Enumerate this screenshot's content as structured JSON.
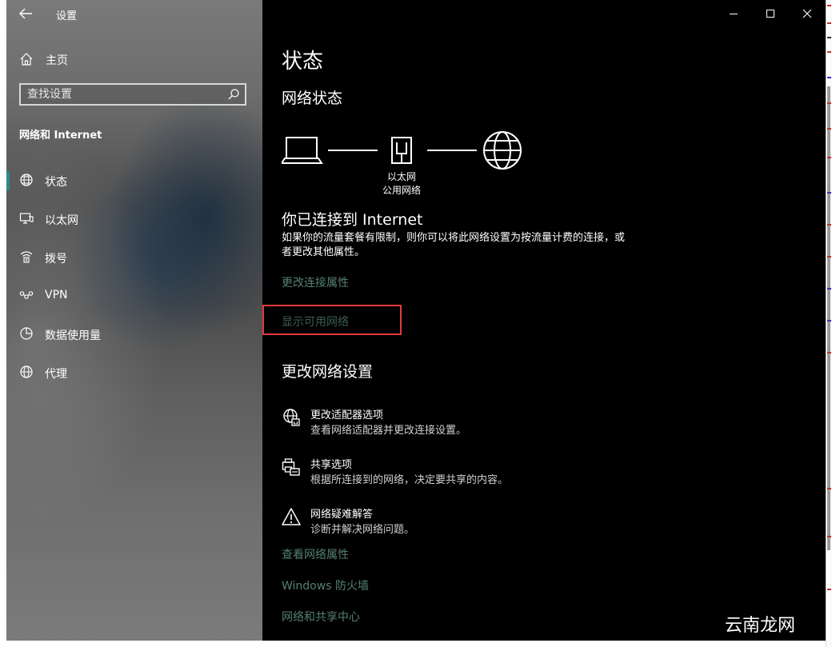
{
  "app": {
    "title": "设置"
  },
  "sidebar": {
    "home_label": "主页",
    "search_placeholder": "查找设置",
    "section_title": "网络和 Internet",
    "items": [
      {
        "label": "状态",
        "icon": "globe-status-icon",
        "active": true
      },
      {
        "label": "以太网",
        "icon": "ethernet-icon",
        "active": false
      },
      {
        "label": "拨号",
        "icon": "dialup-icon",
        "active": false
      },
      {
        "label": "VPN",
        "icon": "vpn-icon",
        "active": false
      },
      {
        "label": "数据使用量",
        "icon": "data-usage-icon",
        "active": false
      },
      {
        "label": "代理",
        "icon": "proxy-globe-icon",
        "active": false
      }
    ]
  },
  "main": {
    "title": "状态",
    "network_status_heading": "网络状态",
    "network": {
      "name": "以太网",
      "type": "公用网络"
    },
    "connected_heading": "你已连接到 Internet",
    "description": "如果你的流量套餐有限制，则你可以将此网络设置为按流量计费的连接，或者更改其他属性。",
    "links_top": {
      "change_properties": "更改连接属性",
      "show_networks": "显示可用网络"
    },
    "change_settings_heading": "更改网络设置",
    "options": [
      {
        "title": "更改适配器选项",
        "desc": "查看网络适配器并更改连接设置。",
        "icon": "adapter-globe-icon"
      },
      {
        "title": "共享选项",
        "desc": "根据所连接到的网络，决定要共享的内容。",
        "icon": "sharing-printer-icon"
      },
      {
        "title": "网络疑难解答",
        "desc": "诊断并解决网络问题。",
        "icon": "warning-triangle-icon"
      }
    ],
    "links_bottom": {
      "view_properties": "查看网络属性",
      "firewall": "Windows 防火墙",
      "sharing_center": "网络和共享中心"
    }
  },
  "colors": {
    "accent": "#2d8a86",
    "link": "#55806f",
    "highlight_box": "#e23a3a"
  },
  "watermark": "云南龙网"
}
